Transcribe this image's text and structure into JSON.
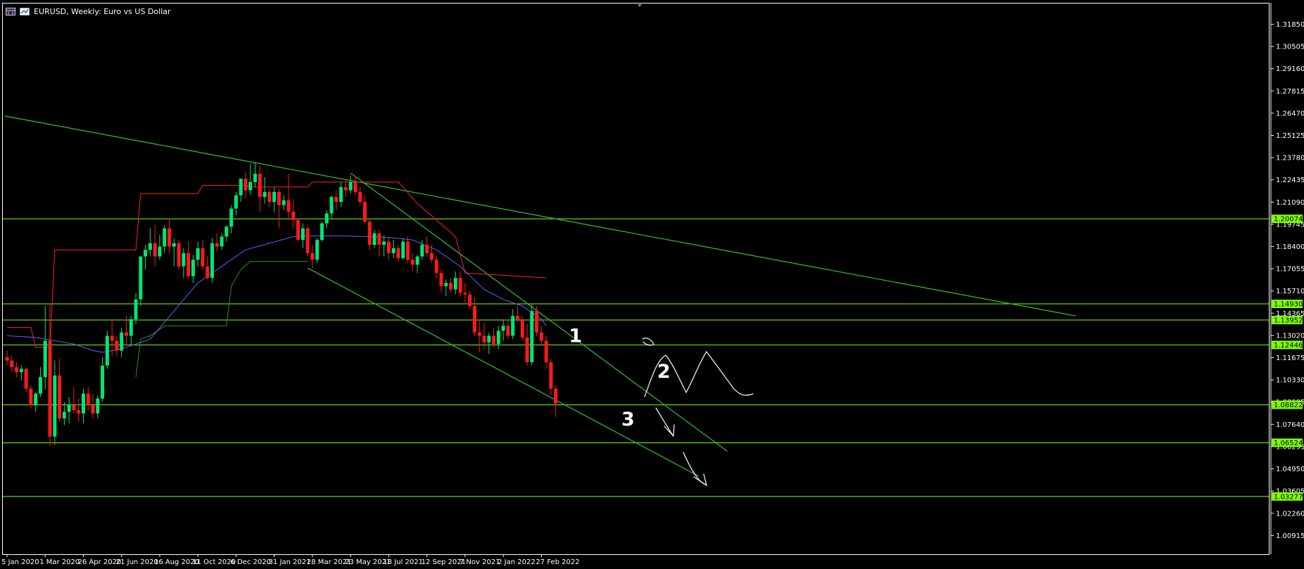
{
  "window": {
    "symbol_title": "EURUSD, Weekly:  Euro vs US Dollar"
  },
  "colors": {
    "background": "#000000",
    "frame": "#ffffff",
    "bull_candle": "#00e676",
    "bear_candle": "#ff1a1a",
    "level_line": "#7fff00",
    "trend_line": "#2fc32f",
    "ma_blue": "#6a5cff",
    "kijun_red": "#ff2020",
    "senkou_green": "#1f9a1f",
    "price_label_bg": "#7fff00",
    "annotation": "#ffffff"
  },
  "chart_data": {
    "type": "candlestick",
    "title": "EURUSD, Weekly:  Euro vs US Dollar",
    "ylim": [
      1.0025,
      1.3255
    ],
    "y_ticks": [
      "1.31850",
      "1.30505",
      "1.29160",
      "1.27815",
      "1.26470",
      "1.25125",
      "1.23780",
      "1.22435",
      "1.21090",
      "1.19745",
      "1.18400",
      "1.17055",
      "1.15710",
      "1.14365",
      "1.13020",
      "1.11675",
      "1.10330",
      "1.08985",
      "1.07640",
      "1.06295",
      "1.04950",
      "1.03605",
      "1.02260",
      "1.00915"
    ],
    "x_tick_labels": [
      "5 Jan 2020",
      "1 Mar 2020",
      "26 Apr 2020",
      "21 Jun 2020",
      "16 Aug 2020",
      "11 Oct 2020",
      "6 Dec 2020",
      "31 Jan 2021",
      "28 Mar 2021",
      "23 May 2021",
      "18 Jul 2021",
      "12 Sep 2021",
      "7 Nov 2021",
      "2 Jan 2022",
      "27 Feb 2022"
    ],
    "x_tick_index": [
      0,
      8,
      16,
      24,
      32,
      40,
      48,
      56,
      64,
      72,
      80,
      88,
      96,
      104,
      112
    ],
    "horizontal_levels": [
      {
        "price": 1.20074,
        "label": "1.20074"
      },
      {
        "price": 1.1493,
        "label": "1.14930"
      },
      {
        "price": 1.13952,
        "label": "1.13952"
      },
      {
        "price": 1.12446,
        "label": "1.12446"
      },
      {
        "price": 1.08822,
        "label": "1.08822"
      },
      {
        "price": 1.06524,
        "label": "1.06524"
      },
      {
        "price": 1.03277,
        "label": "1.03277"
      }
    ],
    "trend_lines": [
      {
        "from": [
          -0.5,
          1.263
        ],
        "to": [
          224,
          1.142
        ]
      },
      {
        "from": [
          72,
          1.2285
        ],
        "to": [
          151,
          1.06
        ]
      },
      {
        "from": [
          63,
          1.171
        ],
        "to": [
          145,
          1.045
        ]
      }
    ],
    "kijun_red": [
      [
        0,
        1.135
      ],
      [
        5,
        1.135
      ],
      [
        6,
        1.123
      ],
      [
        9,
        1.123
      ],
      [
        10,
        1.182
      ],
      [
        27,
        1.182
      ],
      [
        28,
        1.216
      ],
      [
        40,
        1.216
      ],
      [
        41,
        1.221
      ],
      [
        50,
        1.221
      ],
      [
        51,
        1.22
      ],
      [
        63,
        1.22
      ],
      [
        64,
        1.223
      ],
      [
        82,
        1.223
      ],
      [
        83,
        1.22
      ],
      [
        86,
        1.21
      ],
      [
        90,
        1.2
      ],
      [
        94,
        1.19
      ],
      [
        96,
        1.168
      ],
      [
        113,
        1.165
      ]
    ],
    "senkou_green": [
      [
        27,
        1.105
      ],
      [
        28,
        1.128
      ],
      [
        30,
        1.13
      ],
      [
        33,
        1.136
      ],
      [
        46,
        1.136
      ],
      [
        47,
        1.16
      ],
      [
        49,
        1.17
      ],
      [
        51,
        1.175
      ],
      [
        63,
        1.175
      ]
    ],
    "ma_blue": [
      [
        0,
        1.13
      ],
      [
        6,
        1.129
      ],
      [
        10,
        1.127
      ],
      [
        14,
        1.125
      ],
      [
        18,
        1.121
      ],
      [
        20,
        1.12
      ],
      [
        24,
        1.122
      ],
      [
        30,
        1.128
      ],
      [
        35,
        1.145
      ],
      [
        40,
        1.162
      ],
      [
        45,
        1.172
      ],
      [
        50,
        1.182
      ],
      [
        55,
        1.186
      ],
      [
        60,
        1.19
      ],
      [
        65,
        1.1905
      ],
      [
        70,
        1.1905
      ],
      [
        75,
        1.19
      ],
      [
        80,
        1.1895
      ],
      [
        85,
        1.188
      ],
      [
        90,
        1.182
      ],
      [
        95,
        1.172
      ],
      [
        100,
        1.158
      ],
      [
        104,
        1.152
      ],
      [
        108,
        1.148
      ],
      [
        112,
        1.14
      ],
      [
        113,
        1.136
      ]
    ],
    "candles": [
      [
        1.117,
        1.121,
        1.112,
        1.115
      ],
      [
        1.115,
        1.118,
        1.108,
        1.111
      ],
      [
        1.111,
        1.114,
        1.105,
        1.108
      ],
      [
        1.108,
        1.112,
        1.103,
        1.11
      ],
      [
        1.11,
        1.111,
        1.096,
        1.098
      ],
      [
        1.098,
        1.1,
        1.086,
        1.088
      ],
      [
        1.088,
        1.096,
        1.084,
        1.095
      ],
      [
        1.095,
        1.111,
        1.093,
        1.105
      ],
      [
        1.105,
        1.148,
        1.098,
        1.127
      ],
      [
        1.127,
        1.149,
        1.063,
        1.069
      ],
      [
        1.069,
        1.115,
        1.064,
        1.106
      ],
      [
        1.106,
        1.116,
        1.078,
        1.08
      ],
      [
        1.08,
        1.09,
        1.076,
        1.084
      ],
      [
        1.084,
        1.093,
        1.077,
        1.088
      ],
      [
        1.088,
        1.099,
        1.083,
        1.085
      ],
      [
        1.085,
        1.092,
        1.078,
        1.083
      ],
      [
        1.083,
        1.098,
        1.077,
        1.095
      ],
      [
        1.095,
        1.099,
        1.085,
        1.088
      ],
      [
        1.088,
        1.095,
        1.08,
        1.083
      ],
      [
        1.083,
        1.094,
        1.08,
        1.092
      ],
      [
        1.092,
        1.117,
        1.09,
        1.112
      ],
      [
        1.112,
        1.133,
        1.11,
        1.13
      ],
      [
        1.13,
        1.14,
        1.118,
        1.127
      ],
      [
        1.127,
        1.13,
        1.118,
        1.121
      ],
      [
        1.121,
        1.135,
        1.117,
        1.132
      ],
      [
        1.132,
        1.142,
        1.125,
        1.13
      ],
      [
        1.13,
        1.142,
        1.124,
        1.14
      ],
      [
        1.14,
        1.156,
        1.137,
        1.152
      ],
      [
        1.152,
        1.178,
        1.148,
        1.178
      ],
      [
        1.178,
        1.185,
        1.17,
        1.182
      ],
      [
        1.182,
        1.195,
        1.178,
        1.186
      ],
      [
        1.186,
        1.197,
        1.172,
        1.178
      ],
      [
        1.178,
        1.191,
        1.176,
        1.184
      ],
      [
        1.184,
        1.197,
        1.18,
        1.195
      ],
      [
        1.195,
        1.201,
        1.18,
        1.184
      ],
      [
        1.184,
        1.189,
        1.172,
        1.186
      ],
      [
        1.186,
        1.188,
        1.17,
        1.172
      ],
      [
        1.172,
        1.183,
        1.165,
        1.18
      ],
      [
        1.18,
        1.187,
        1.165,
        1.166
      ],
      [
        1.166,
        1.179,
        1.162,
        1.176
      ],
      [
        1.176,
        1.187,
        1.172,
        1.183
      ],
      [
        1.183,
        1.188,
        1.17,
        1.172
      ],
      [
        1.172,
        1.178,
        1.164,
        1.165
      ],
      [
        1.165,
        1.189,
        1.162,
        1.186
      ],
      [
        1.186,
        1.192,
        1.181,
        1.184
      ],
      [
        1.184,
        1.192,
        1.182,
        1.19
      ],
      [
        1.19,
        1.197,
        1.187,
        1.196
      ],
      [
        1.196,
        1.209,
        1.192,
        1.207
      ],
      [
        1.207,
        1.217,
        1.203,
        1.215
      ],
      [
        1.215,
        1.225,
        1.211,
        1.225
      ],
      [
        1.225,
        1.229,
        1.213,
        1.218
      ],
      [
        1.218,
        1.234,
        1.215,
        1.223
      ],
      [
        1.223,
        1.235,
        1.22,
        1.228
      ],
      [
        1.228,
        1.233,
        1.205,
        1.214
      ],
      [
        1.214,
        1.226,
        1.21,
        1.217
      ],
      [
        1.217,
        1.219,
        1.208,
        1.211
      ],
      [
        1.211,
        1.22,
        1.205,
        1.217
      ],
      [
        1.217,
        1.219,
        1.195,
        1.209
      ],
      [
        1.209,
        1.215,
        1.206,
        1.212
      ],
      [
        1.212,
        1.228,
        1.2,
        1.205
      ],
      [
        1.205,
        1.213,
        1.195,
        1.2
      ],
      [
        1.2,
        1.201,
        1.187,
        1.188
      ],
      [
        1.188,
        1.198,
        1.183,
        1.195
      ],
      [
        1.195,
        1.196,
        1.178,
        1.18
      ],
      [
        1.18,
        1.185,
        1.171,
        1.176
      ],
      [
        1.176,
        1.189,
        1.174,
        1.188
      ],
      [
        1.188,
        1.199,
        1.187,
        1.198
      ],
      [
        1.198,
        1.206,
        1.195,
        1.204
      ],
      [
        1.204,
        1.215,
        1.201,
        1.214
      ],
      [
        1.214,
        1.218,
        1.206,
        1.211
      ],
      [
        1.211,
        1.223,
        1.208,
        1.22
      ],
      [
        1.22,
        1.224,
        1.214,
        1.218
      ],
      [
        1.218,
        1.227,
        1.216,
        1.223
      ],
      [
        1.223,
        1.226,
        1.215,
        1.217
      ],
      [
        1.217,
        1.22,
        1.209,
        1.211
      ],
      [
        1.211,
        1.215,
        1.198,
        1.199
      ],
      [
        1.199,
        1.2,
        1.182,
        1.185
      ],
      [
        1.185,
        1.194,
        1.183,
        1.192
      ],
      [
        1.192,
        1.194,
        1.178,
        1.185
      ],
      [
        1.185,
        1.191,
        1.178,
        1.187
      ],
      [
        1.187,
        1.19,
        1.176,
        1.18
      ],
      [
        1.18,
        1.188,
        1.177,
        1.183
      ],
      [
        1.183,
        1.185,
        1.175,
        1.177
      ],
      [
        1.177,
        1.189,
        1.176,
        1.187
      ],
      [
        1.187,
        1.19,
        1.174,
        1.176
      ],
      [
        1.176,
        1.18,
        1.169,
        1.173
      ],
      [
        1.173,
        1.179,
        1.168,
        1.178
      ],
      [
        1.178,
        1.188,
        1.176,
        1.185
      ],
      [
        1.185,
        1.19,
        1.178,
        1.18
      ],
      [
        1.18,
        1.185,
        1.174,
        1.176
      ],
      [
        1.176,
        1.178,
        1.165,
        1.168
      ],
      [
        1.168,
        1.17,
        1.156,
        1.16
      ],
      [
        1.16,
        1.164,
        1.154,
        1.162
      ],
      [
        1.162,
        1.165,
        1.156,
        1.158
      ],
      [
        1.158,
        1.169,
        1.155,
        1.165
      ],
      [
        1.165,
        1.169,
        1.154,
        1.156
      ],
      [
        1.156,
        1.162,
        1.15,
        1.155
      ],
      [
        1.155,
        1.157,
        1.146,
        1.148
      ],
      [
        1.148,
        1.153,
        1.13,
        1.132
      ],
      [
        1.132,
        1.139,
        1.12,
        1.13
      ],
      [
        1.13,
        1.138,
        1.122,
        1.126
      ],
      [
        1.126,
        1.132,
        1.119,
        1.13
      ],
      [
        1.13,
        1.135,
        1.123,
        1.125
      ],
      [
        1.125,
        1.136,
        1.122,
        1.133
      ],
      [
        1.133,
        1.14,
        1.127,
        1.136
      ],
      [
        1.136,
        1.14,
        1.128,
        1.13
      ],
      [
        1.13,
        1.146,
        1.128,
        1.142
      ],
      [
        1.142,
        1.148,
        1.138,
        1.14
      ],
      [
        1.14,
        1.142,
        1.127,
        1.129
      ],
      [
        1.129,
        1.137,
        1.112,
        1.114
      ],
      [
        1.114,
        1.149,
        1.112,
        1.145
      ],
      [
        1.145,
        1.148,
        1.13,
        1.132
      ],
      [
        1.132,
        1.136,
        1.125,
        1.127
      ],
      [
        1.127,
        1.13,
        1.11,
        1.114
      ],
      [
        1.114,
        1.116,
        1.094,
        1.098
      ],
      [
        1.098,
        1.1,
        1.081,
        1.089
      ]
    ],
    "annotations": [
      {
        "text": "1",
        "at": [
          118.5,
          1.13
        ]
      },
      {
        "text": "2",
        "at": [
          137,
          1.1085
        ]
      },
      {
        "text": "3",
        "at": [
          129.5,
          1.0795
        ]
      }
    ]
  }
}
